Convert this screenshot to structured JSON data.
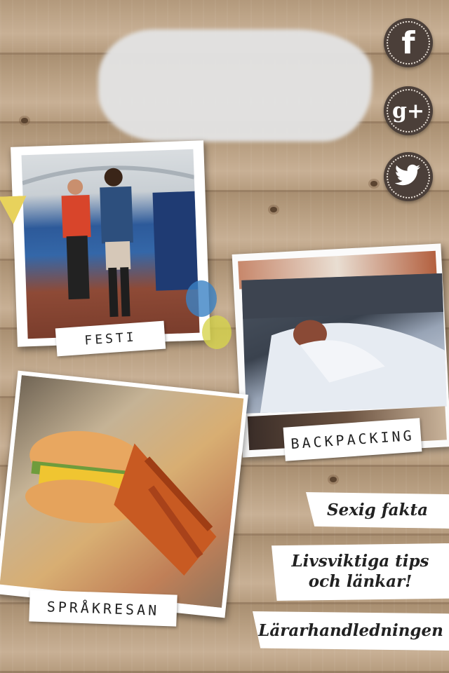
{
  "social": {
    "facebook": {
      "glyph": "f",
      "icon": "facebook-icon"
    },
    "google": {
      "glyph": "g+",
      "icon": "google-plus-icon"
    },
    "twitter": {
      "glyph": "🐦",
      "icon": "twitter-icon"
    }
  },
  "cards": {
    "festival": {
      "label": "FESTI"
    },
    "backpacking": {
      "label": "BACKPACKING"
    },
    "sprakresan": {
      "label": "SPRÅKRESAN"
    }
  },
  "links": {
    "sexig_fakta": "Sexig fakta",
    "livsviktiga_line1": "Livsviktiga tips",
    "livsviktiga_line2": "och länkar!",
    "lararhandledningen": "Lärarhandledningen"
  },
  "colors": {
    "social_bg": "#4b3f39",
    "wood": "#bba285",
    "banner_bg": "#ffffff"
  }
}
